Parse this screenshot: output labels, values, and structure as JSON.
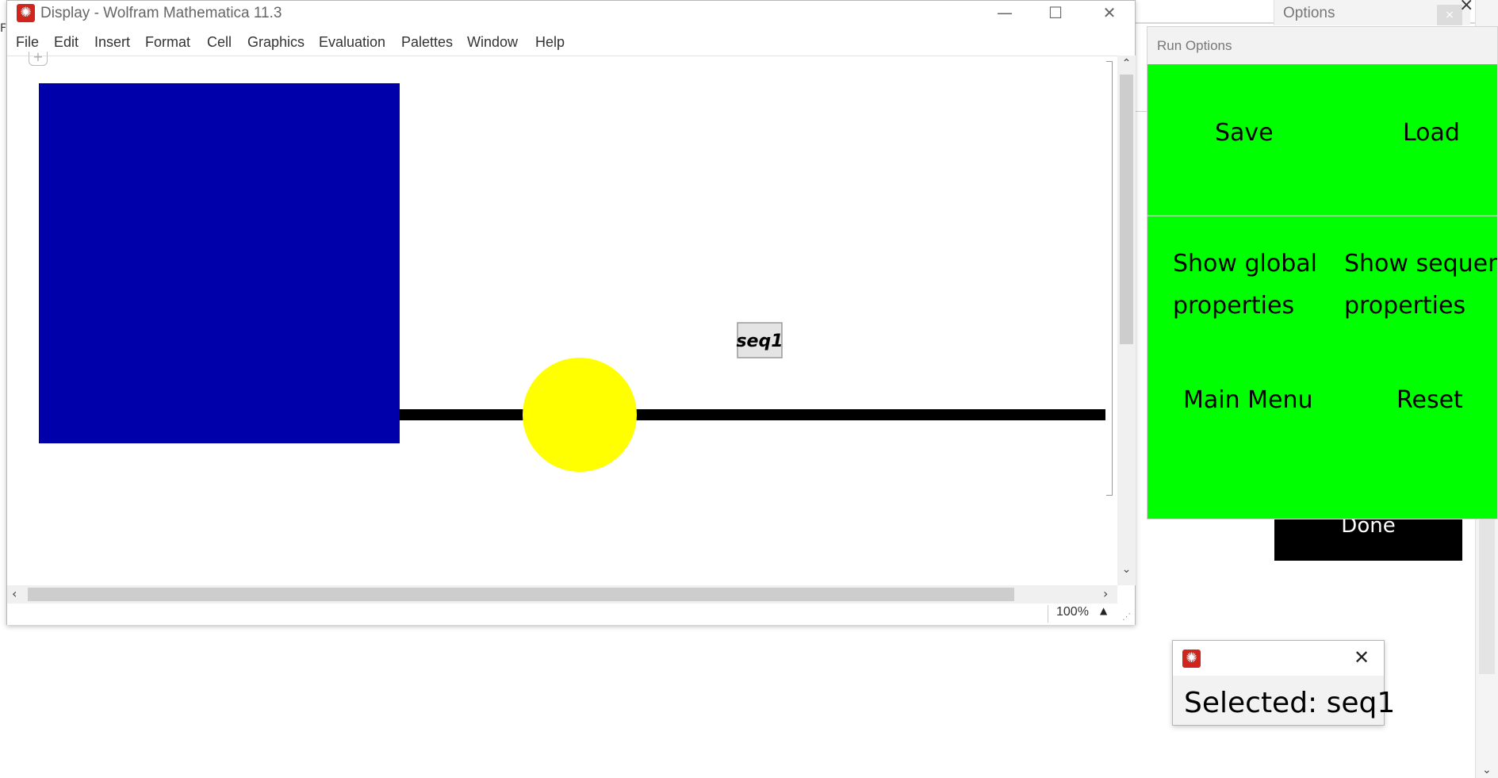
{
  "main_window": {
    "title": "Display - Wolfram Mathematica 11.3",
    "app_icon": "mathematica-spikey-icon",
    "controls": {
      "minimize": "—",
      "maximize": "☐",
      "close": "✕"
    },
    "menu": [
      "File",
      "Edit",
      "Insert",
      "Format",
      "Cell",
      "Graphics",
      "Evaluation",
      "Palettes",
      "Window",
      "Help"
    ],
    "cell_insert": "+",
    "graphics": {
      "square_color": "#0000aa",
      "line_color": "#000000",
      "circle_color": "#ffff00",
      "label": "seq1"
    },
    "zoom": "100%"
  },
  "background_window": {
    "title": "Options",
    "close": "×"
  },
  "run_options": {
    "title": "Run Options",
    "background": "#00ff00",
    "buttons": {
      "save": "Save",
      "load": "Load",
      "show_global_l1": "Show global",
      "show_global_l2": "properties",
      "show_sequence_l1": "Show sequence",
      "show_sequence_l2": "properties",
      "main_menu": "Main Menu",
      "reset": "Reset"
    }
  },
  "done_button": {
    "label": "Done"
  },
  "selected_popup": {
    "icon": "mathematica-spikey-icon",
    "close": "✕",
    "text": "Selected: seq1"
  }
}
